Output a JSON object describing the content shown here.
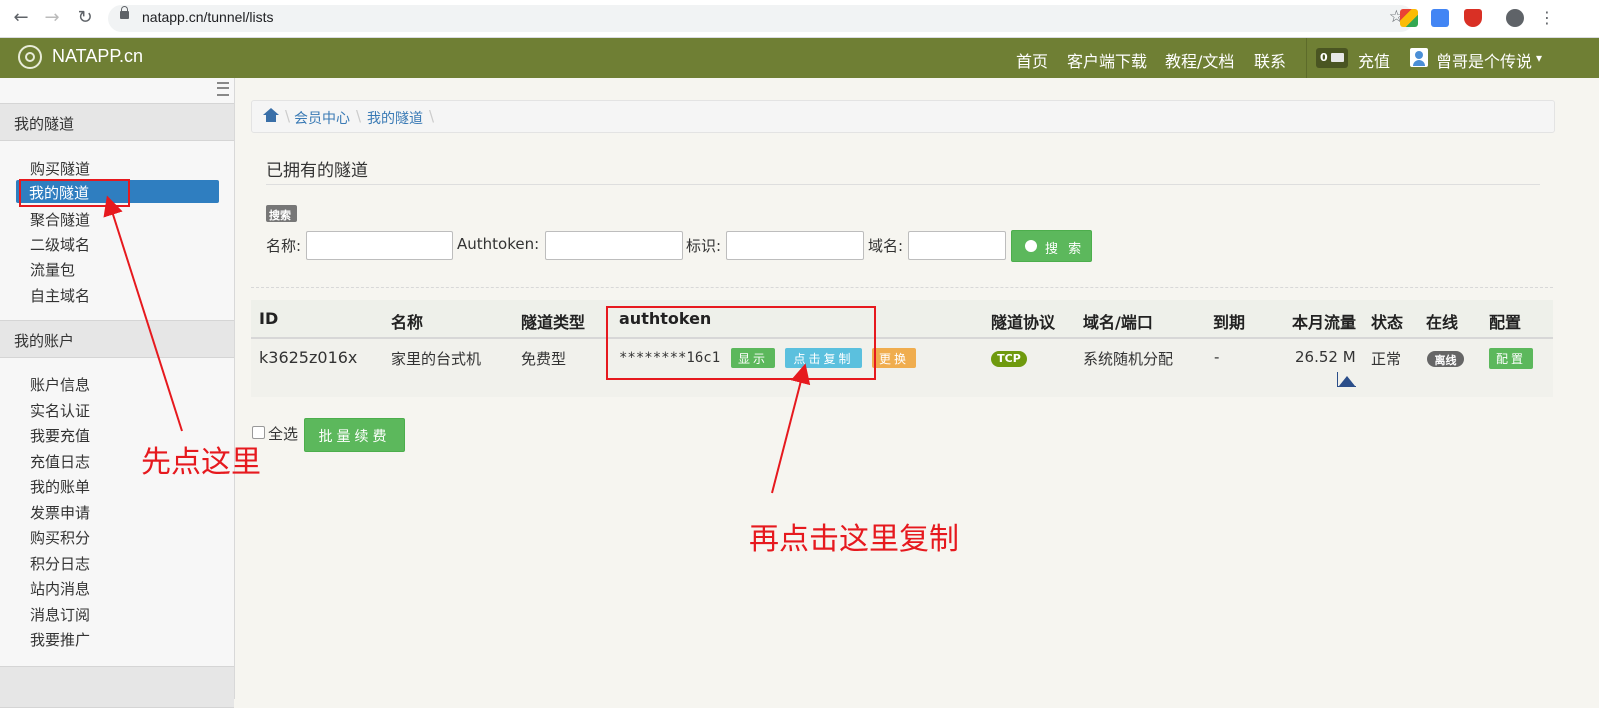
{
  "browser": {
    "url": "natapp.cn/tunnel/lists",
    "icons": [
      "back-icon",
      "forward-icon",
      "reload-icon",
      "lock-icon",
      "star-icon",
      "profile-icon"
    ]
  },
  "topnav": {
    "brand": "NATAPP.cn",
    "links": [
      "首页",
      "客户端下载",
      "教程/文档",
      "联系"
    ],
    "message_count": "0",
    "recharge": "充值",
    "user": "曾哥是个传说",
    "caret": "▾"
  },
  "sidebar": {
    "section1": {
      "title": "我的隧道",
      "items": [
        "购买隧道",
        "我的隧道",
        "聚合隧道",
        "二级域名",
        "流量包",
        "自主域名"
      ]
    },
    "section2": {
      "title": "我的账户",
      "items": [
        "账户信息",
        "实名认证",
        "我要充值",
        "充值日志",
        "我的账单",
        "发票申请",
        "购买积分",
        "积分日志",
        "站内消息",
        "消息订阅",
        "我要推广"
      ]
    }
  },
  "breadcrumb": [
    "会员中心",
    "我的隧道"
  ],
  "page_title": "已拥有的隧道",
  "search": {
    "badge": "搜索",
    "labels": [
      "名称:",
      "Authtoken:",
      "标识:",
      "域名:"
    ],
    "button": "搜 索"
  },
  "table": {
    "headers": [
      "ID",
      "名称",
      "隧道类型",
      "authtoken",
      "隧道协议",
      "域名/端口",
      "到期",
      "本月流量",
      "状态",
      "在线",
      "配置"
    ],
    "row": {
      "id": "k3625z016x",
      "name": "家里的台式机",
      "type": "免费型",
      "authtoken": "********16c1",
      "show_btn": "显示",
      "copy_btn": "点击复制",
      "change_btn": "更换",
      "protocol": "TCP",
      "domain": "系统随机分配",
      "expire": "-",
      "traffic": "26.52 M",
      "status": "正常",
      "online": "离线",
      "config_btn": "配置"
    }
  },
  "select_all": "全选",
  "batch_renew": "批量续费",
  "annotations": {
    "first": "先点这里",
    "second": "再点击这里复制"
  },
  "colors": {
    "nav_green": "#6f7f34",
    "active_blue": "#2f7ec0",
    "btn_green": "#5cb85c",
    "btn_cyan": "#5bc0de",
    "btn_orange": "#f0ad4e",
    "pill_green": "#6f9a0e",
    "pill_gray": "#666666",
    "annotation_red": "#e6191e"
  }
}
